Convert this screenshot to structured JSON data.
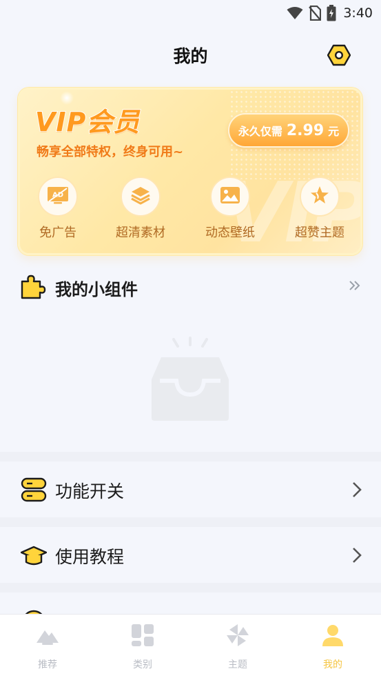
{
  "status_bar": {
    "time": "3:40",
    "icons": [
      "wifi-icon",
      "no-sim-icon",
      "battery-charging-icon"
    ]
  },
  "header": {
    "title": "我的",
    "settings_icon": "hexagon-gear-icon"
  },
  "vip_card": {
    "title": "VIP会员",
    "subtitle": "畅享全部特权，终身可用~",
    "watermark": "VIP",
    "price": {
      "prefix": "永久仅需",
      "value": "2.99",
      "unit": "元"
    },
    "features": [
      {
        "icon": "no-ads-icon",
        "label": "免广告"
      },
      {
        "icon": "layers-icon",
        "label": "超清素材"
      },
      {
        "icon": "picture-icon",
        "label": "动态壁纸"
      },
      {
        "icon": "star-icon",
        "label": "超赞主题"
      }
    ],
    "colors": {
      "accent": "#ff9a1f",
      "label": "#b06a24",
      "pill_top": "#ffd37a",
      "pill_bottom": "#ffa736"
    }
  },
  "widgets": {
    "title": "我的小组件",
    "more_icon": "double-chevron-right-icon",
    "empty_icon": "empty-inbox-icon"
  },
  "rows": [
    {
      "icon": "toggle-switch-icon",
      "label": "功能开关"
    },
    {
      "icon": "graduation-cap-icon",
      "label": "使用教程"
    },
    {
      "icon": "smiley-icon",
      "label": ""
    }
  ],
  "bottom_nav": {
    "items": [
      {
        "icon": "mountain-icon",
        "label": "推荐"
      },
      {
        "icon": "category-grid-icon",
        "label": "类别"
      },
      {
        "icon": "pinwheel-icon",
        "label": "主题"
      },
      {
        "icon": "person-icon",
        "label": "我的"
      }
    ],
    "active_index": 3,
    "colors": {
      "active": "#f5c542",
      "inactive": "#b9bcc4"
    }
  }
}
